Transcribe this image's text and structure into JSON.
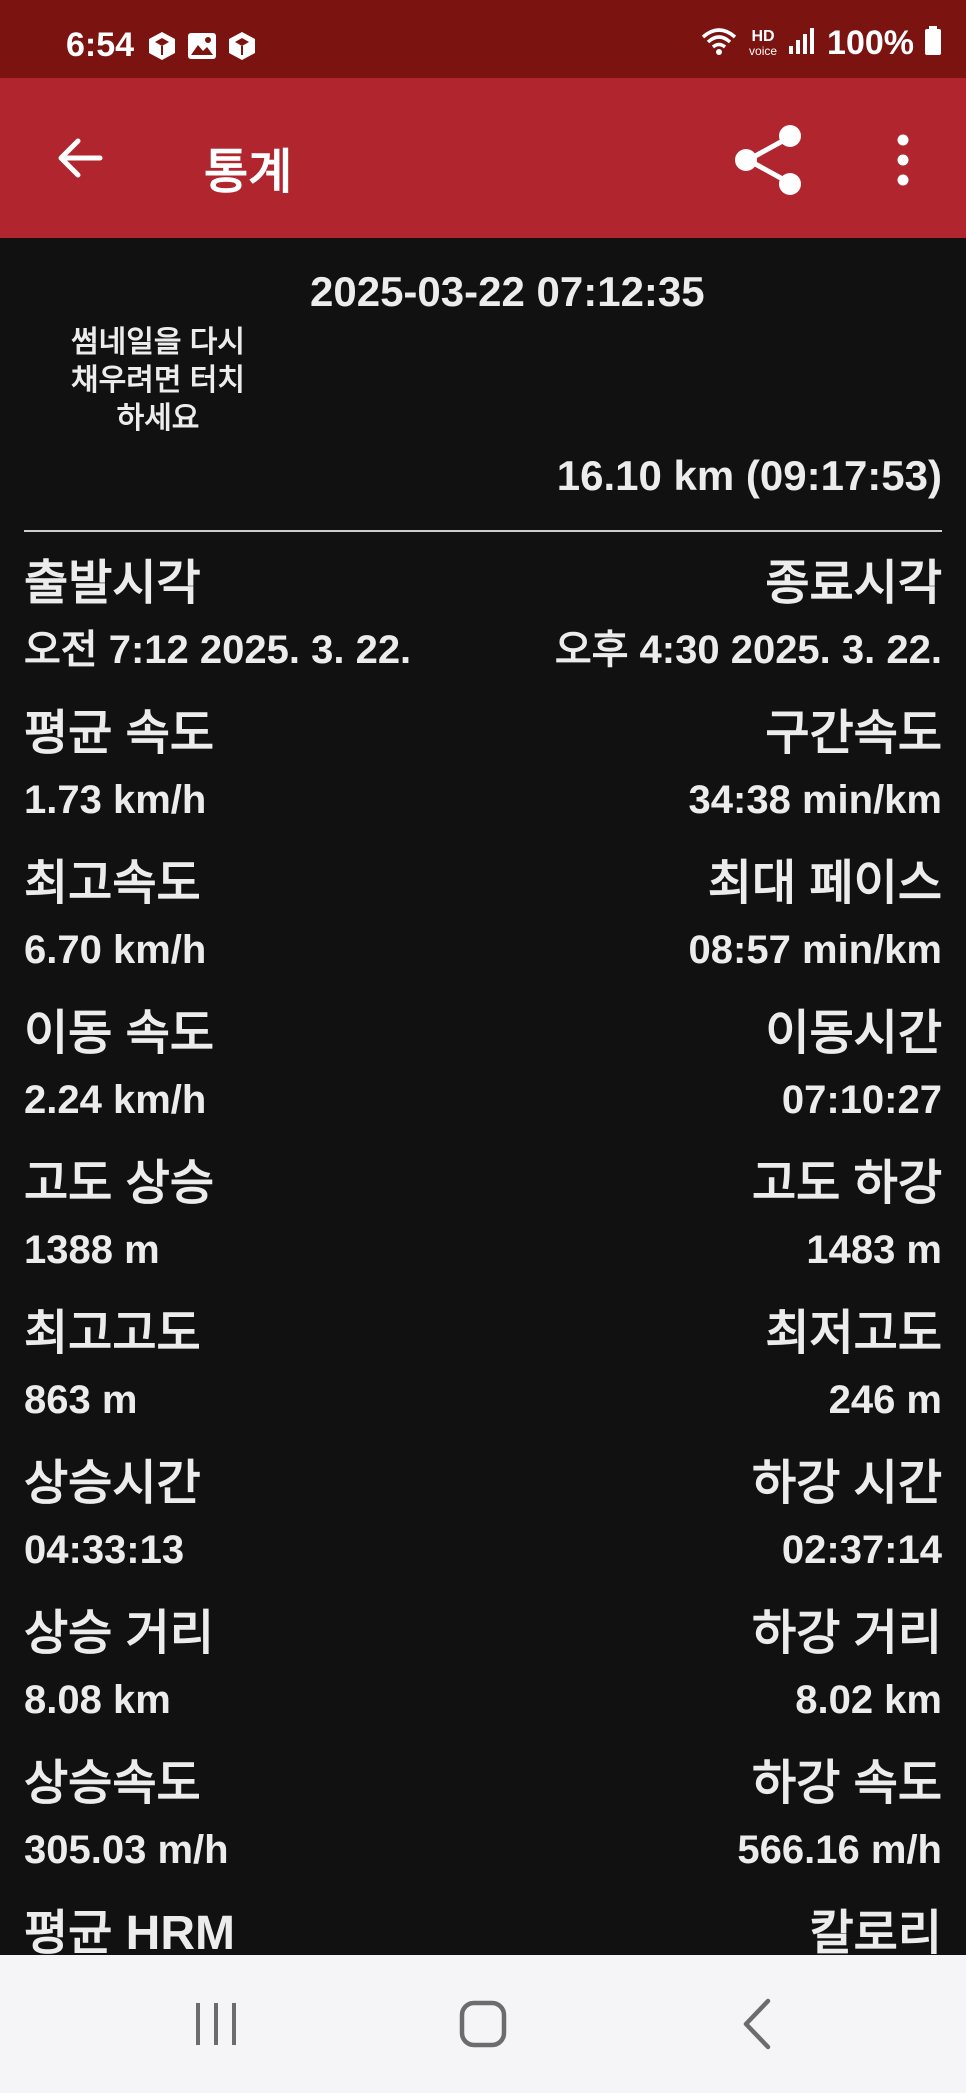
{
  "status": {
    "time": "6:54",
    "battery": "100%",
    "hd_label": "HD",
    "voice_label": "voice"
  },
  "header": {
    "title": "통계"
  },
  "summary": {
    "datetime": "2025-03-22 07:12:35",
    "thumbnail_hint": "썸네일을 다시 채우려면 터치하세요",
    "distance_time": "16.10 km (09:17:53)"
  },
  "stats": [
    {
      "left_label": "출발시각",
      "left_value": "오전 7:12 2025. 3. 22.",
      "right_label": "종료시각",
      "right_value": "오후 4:30 2025. 3. 22."
    },
    {
      "left_label": "평균 속도",
      "left_value": "1.73 km/h",
      "right_label": "구간속도",
      "right_value": "34:38 min/km"
    },
    {
      "left_label": "최고속도",
      "left_value": "6.70 km/h",
      "right_label": "최대 페이스",
      "right_value": "08:57 min/km"
    },
    {
      "left_label": "이동 속도",
      "left_value": "2.24 km/h",
      "right_label": "이동시간",
      "right_value": "07:10:27"
    },
    {
      "left_label": "고도 상승",
      "left_value": "1388 m",
      "right_label": "고도 하강",
      "right_value": "1483 m"
    },
    {
      "left_label": "최고고도",
      "left_value": "863 m",
      "right_label": "최저고도",
      "right_value": "246 m"
    },
    {
      "left_label": "상승시간",
      "left_value": "04:33:13",
      "right_label": "하강 시간",
      "right_value": "02:37:14"
    },
    {
      "left_label": "상승 거리",
      "left_value": "8.08 km",
      "right_label": "하강 거리",
      "right_value": "8.02 km"
    },
    {
      "left_label": "상승속도",
      "left_value": "305.03 m/h",
      "right_label": "하강 속도",
      "right_value": "566.16 m/h"
    },
    {
      "left_label": "평균 HRM",
      "left_value": "",
      "right_label": "칼로리",
      "right_value": ""
    }
  ],
  "icons": {
    "back": "arrow-back-icon",
    "share": "share-icon",
    "more": "more-vert-icon",
    "nav_recents": "recents-icon",
    "nav_home": "home-icon",
    "nav_back": "nav-back-icon"
  },
  "colors": {
    "status_bar": "#7b1310",
    "app_bar": "#b0252e",
    "background": "#111111",
    "text": "#ececec",
    "nav_bar": "#f5f5f7"
  }
}
